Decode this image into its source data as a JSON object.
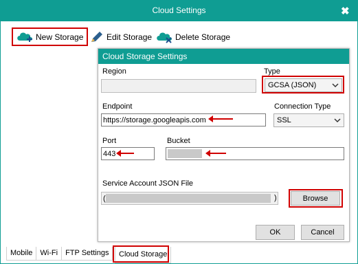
{
  "window": {
    "title": "Cloud Settings",
    "close_glyph": "✖"
  },
  "toolbar": {
    "new_label": "New Storage",
    "edit_label": "Edit Storage",
    "delete_label": "Delete Storage"
  },
  "dialog": {
    "title": "Cloud Storage Settings",
    "region_label": "Region",
    "region_value": "",
    "type_label": "Type",
    "type_value": "GCSA (JSON)",
    "endpoint_label": "Endpoint",
    "endpoint_value": "https://storage.googleapis.com",
    "connection_type_label": "Connection Type",
    "connection_type_value": "SSL",
    "port_label": "Port",
    "port_value": "443",
    "bucket_label": "Bucket",
    "json_file_label": "Service Account JSON File",
    "json_file_prefix": "(",
    "json_file_suffix": ")",
    "browse_label": "Browse",
    "ok_label": "OK",
    "cancel_label": "Cancel"
  },
  "tabs": [
    {
      "label": "Mobile"
    },
    {
      "label": "Wi-Fi"
    },
    {
      "label": "FTP Settings"
    },
    {
      "label": "Cloud Storage"
    }
  ],
  "colors": {
    "accent": "#0f9d93",
    "highlight": "#d00000"
  }
}
